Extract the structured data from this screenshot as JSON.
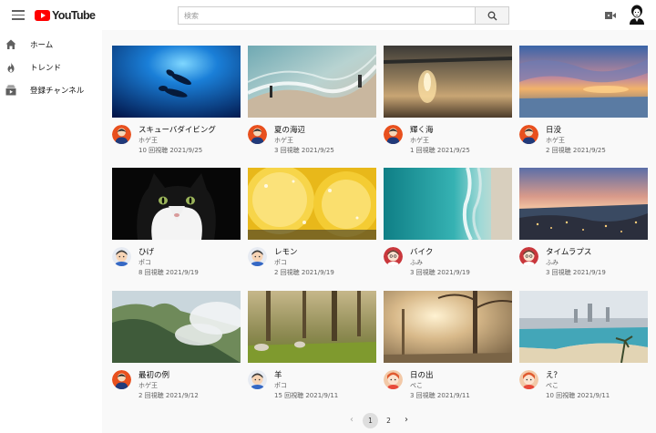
{
  "header": {
    "logo_text": "YouTube",
    "search_placeholder": "検索",
    "icons": [
      "menu-icon",
      "youtube-logo-icon",
      "search-icon",
      "video-camera-icon",
      "user-avatar-icon"
    ]
  },
  "sidebar": {
    "items": [
      {
        "label": "ホーム",
        "icon": "home-icon"
      },
      {
        "label": "トレンド",
        "icon": "flame-icon"
      },
      {
        "label": "登録チャンネル",
        "icon": "subscriptions-icon"
      }
    ]
  },
  "videos": [
    {
      "title": "スキューバダイビング",
      "channel": "ホゲ王",
      "meta": "10 回視聴 2021/9/25"
    },
    {
      "title": "夏の海辺",
      "channel": "ホゲ王",
      "meta": "3 回視聴 2021/9/25"
    },
    {
      "title": "輝く海",
      "channel": "ホゲ王",
      "meta": "1 回視聴 2021/9/25"
    },
    {
      "title": "日没",
      "channel": "ホゲ王",
      "meta": "2 回視聴 2021/9/25"
    },
    {
      "title": "ひげ",
      "channel": "ポコ",
      "meta": "8 回視聴 2021/9/19"
    },
    {
      "title": "レモン",
      "channel": "ポコ",
      "meta": "2 回視聴 2021/9/19"
    },
    {
      "title": "バイク",
      "channel": "ふみ",
      "meta": "3 回視聴 2021/9/19"
    },
    {
      "title": "タイムラプス",
      "channel": "ふみ",
      "meta": "3 回視聴 2021/9/19"
    },
    {
      "title": "最初の例",
      "channel": "ホゲ王",
      "meta": "2 回視聴 2021/9/12"
    },
    {
      "title": "羊",
      "channel": "ポコ",
      "meta": "15 回視聴 2021/9/11"
    },
    {
      "title": "日の出",
      "channel": "ぺこ",
      "meta": "3 回視聴 2021/9/11"
    },
    {
      "title": "え？",
      "channel": "ぺこ",
      "meta": "10 回視聴 2021/9/11"
    }
  ],
  "pagination": {
    "prev": "‹",
    "pages": [
      "1",
      "2"
    ],
    "current": "1",
    "next": "›"
  },
  "colors": {
    "brand": "#ff0000",
    "background": "#f9f9f9",
    "header": "#ffffff",
    "text_secondary": "#606060"
  }
}
